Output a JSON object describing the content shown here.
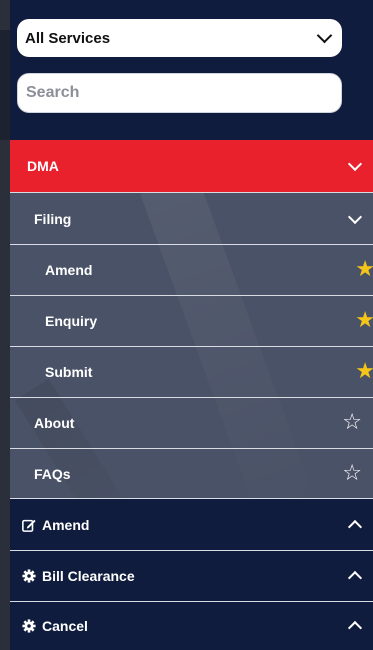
{
  "filters": {
    "service_select": {
      "value": "All Services"
    },
    "search": {
      "placeholder": "Search"
    }
  },
  "menu": {
    "dma": {
      "label": "DMA",
      "expanded": true
    },
    "filing": {
      "label": "Filing",
      "expanded": true,
      "items": [
        {
          "label": "Amend",
          "starred": true
        },
        {
          "label": "Enquiry",
          "starred": true
        },
        {
          "label": "Submit",
          "starred": true
        }
      ]
    },
    "about": {
      "label": "About",
      "starred": false
    },
    "faqs": {
      "label": "FAQs",
      "starred": false
    },
    "sections": [
      {
        "label": "Amend",
        "icon": "edit-icon"
      },
      {
        "label": "Bill Clearance",
        "icon": "gear-icon"
      },
      {
        "label": "Cancel",
        "icon": "gear-icon"
      }
    ]
  },
  "colors": {
    "background": "#0f1c3d",
    "accent": "#e8212d",
    "submenu_bg": "#4a5267",
    "star": "#f5c518"
  }
}
